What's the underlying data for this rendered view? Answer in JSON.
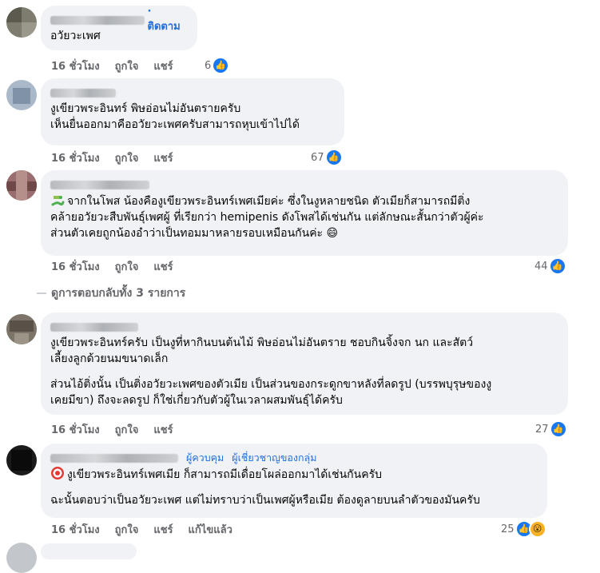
{
  "comments": [
    {
      "name_row": {
        "follow_label": "· ติดตาม"
      },
      "paragraphs": [
        "อวัยวะเพศ"
      ],
      "time": "16 ชั่วโมง",
      "like_label": "ถูกใจ",
      "share_label": "แชร์",
      "reaction_count": "6"
    },
    {
      "paragraphs": [
        "งูเขียวพระอินทร์ พิษอ่อนไม่อันตรายครับ\nเห็นยื่นออกมาคืออวัยวะเพศครับสามารถหุบเข้าไปได้"
      ],
      "time": "16 ชั่วโมง",
      "like_label": "ถูกใจ",
      "share_label": "แชร์",
      "reaction_count": "67"
    },
    {
      "paragraphs": [
        "จากในโพส น้องคืองูเขียวพระอินทร์เพศเมียค่ะ ซึ่งในงูหลายชนิด ตัวเมียก็สามารถมีติ่ง",
        "คล้ายอวัยวะสืบพันธุ์เพศผู้ ที่เรียกว่า hemipenis ดังโพสได้เช่นกัน แต่ลักษณะสั้นกว่าตัวผู้ค่ะ",
        "ส่วนตัวเคยถูกน้องอำว่าเป็นทอมมาหลายรอบเหมือนกันค่ะ 😄"
      ],
      "time": "16 ชั่วโมง",
      "like_label": "ถูกใจ",
      "share_label": "แชร์",
      "reaction_count": "44"
    },
    {
      "paragraphs": [
        "งูเขียวพระอินทร์ครับ เป็นงูที่หากินบนต้นไม้ พิษอ่อนไม่อันตราย ชอบกินจิ้งจก นก และสัตว์\nเลี้ยงลูกด้วยนมขนาดเล็ก",
        "ส่วนไอ้ติ่งนั้น เป็นติ่งอวัยวะเพศของตัวเมีย เป็นส่วนของกระดูกขาหลังที่ลดรูป (บรรพบุรุษของงู\nเคยมีขา) ถึงจะลดรูป ก็ใช่เกี่ยวกับตัวผู้ในเวลาผสมพันธุ์ได้ครับ"
      ],
      "time": "16 ชั่วโมง",
      "like_label": "ถูกใจ",
      "share_label": "แชร์",
      "reaction_count": "27"
    },
    {
      "badges": [
        "ผู้ควบคุม",
        "ผู้เชี่ยวชาญของกลุ่ม"
      ],
      "paragraphs": [
        "งูเขียวพระอินทร์เพศเมีย ก็สามารถมีเดื่อยโผล่ออกมาได้เช่นกันครับ",
        "ฉะนั้นตอบว่าเป็นอวัยวะเพศ แต่ไม่ทราบว่าเป็นเพศผู้หรือเมีย ต้องดูลายบนลำตัวของมันครับ"
      ],
      "time": "16 ชั่วโมง",
      "like_label": "ถูกใจ",
      "share_label": "แชร์",
      "edited_label": "แก้ไขแล้ว",
      "reaction_count": "25"
    }
  ],
  "view_replies": "ดูการตอบกลับทั้ง 3 รายการ",
  "icons": {
    "like": "like-reaction-icon",
    "wow": "wow-reaction-icon",
    "snake": "snake-emoji-icon",
    "target": "target-emoji-icon"
  },
  "colors": {
    "bubble": "#f0f2f5",
    "link": "#216fdb",
    "meta": "#65676b",
    "like": "#1877f2"
  }
}
